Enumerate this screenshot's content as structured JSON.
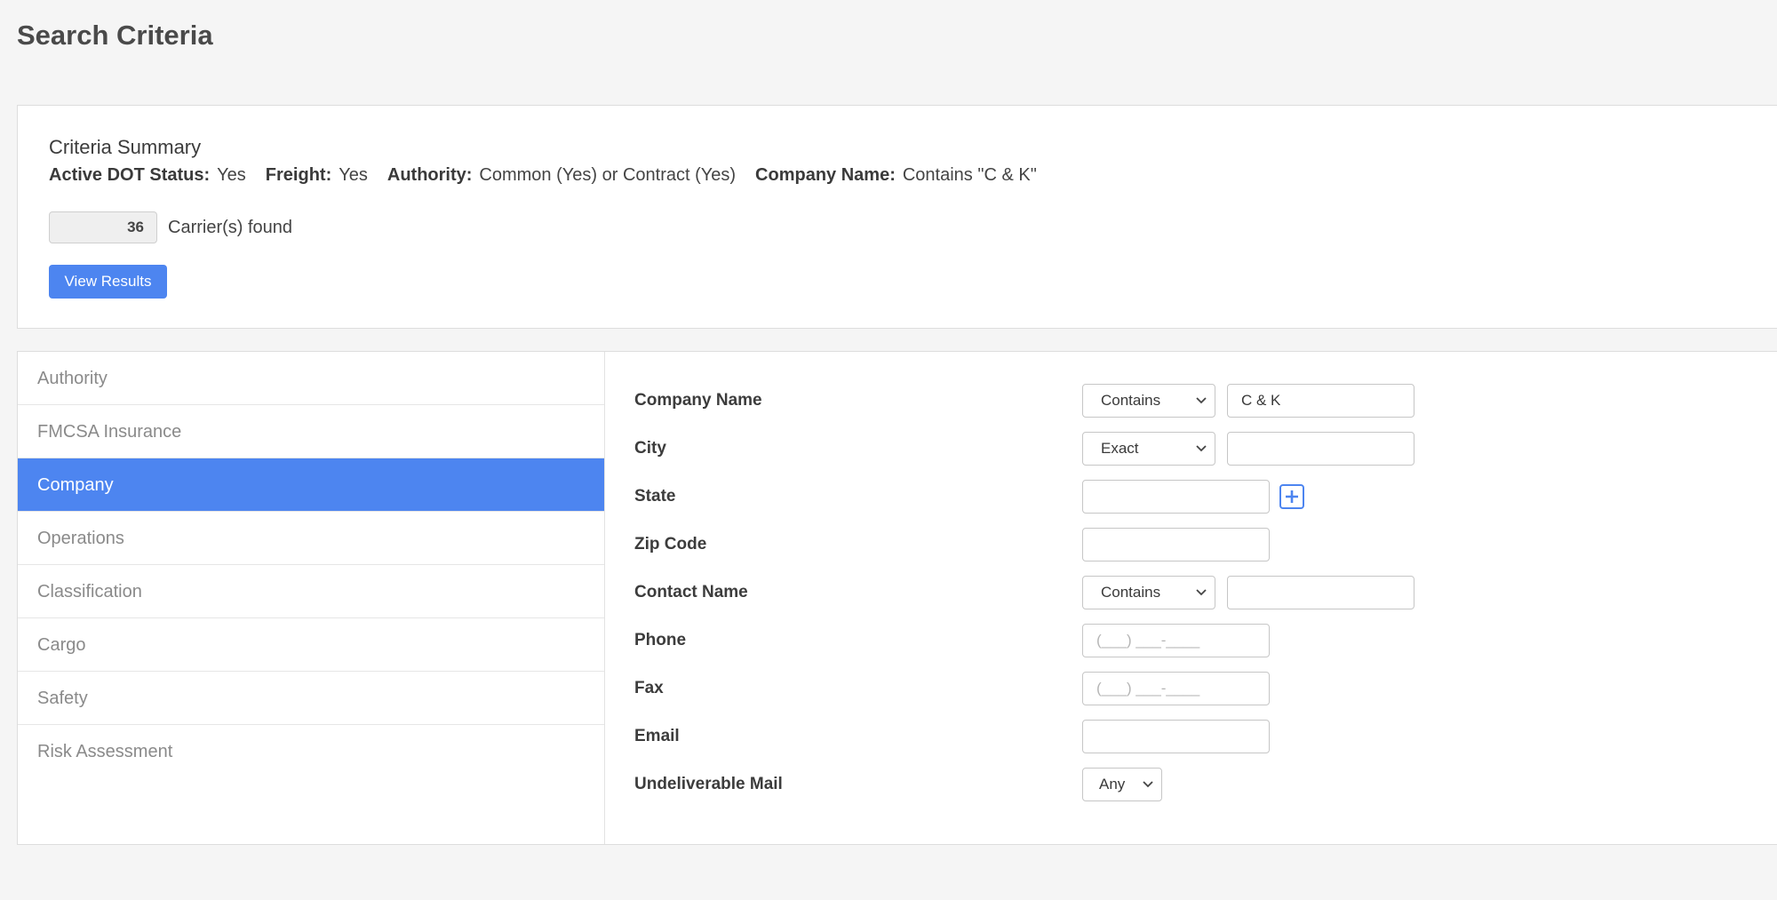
{
  "page": {
    "title": "Search Criteria"
  },
  "summary": {
    "title": "Criteria Summary",
    "criteria": [
      {
        "label": "Active DOT Status:",
        "value": "Yes"
      },
      {
        "label": "Freight:",
        "value": "Yes"
      },
      {
        "label": "Authority:",
        "value": "Common (Yes) or Contract (Yes)"
      },
      {
        "label": "Company Name:",
        "value": "Contains \"C & K\""
      }
    ],
    "count": "36",
    "count_label": "Carrier(s) found",
    "view_results_label": "View Results"
  },
  "sidebar": {
    "items": [
      {
        "label": "Authority",
        "active": false
      },
      {
        "label": "FMCSA Insurance",
        "active": false
      },
      {
        "label": "Company",
        "active": true
      },
      {
        "label": "Operations",
        "active": false
      },
      {
        "label": "Classification",
        "active": false
      },
      {
        "label": "Cargo",
        "active": false
      },
      {
        "label": "Safety",
        "active": false
      },
      {
        "label": "Risk Assessment",
        "active": false
      }
    ]
  },
  "form": {
    "company_name": {
      "label": "Company Name",
      "match": "Contains",
      "value": "C & K"
    },
    "city": {
      "label": "City",
      "match": "Exact",
      "value": ""
    },
    "state": {
      "label": "State",
      "value": ""
    },
    "zip": {
      "label": "Zip Code",
      "value": ""
    },
    "contact_name": {
      "label": "Contact Name",
      "match": "Contains",
      "value": ""
    },
    "phone": {
      "label": "Phone",
      "placeholder": "(___) ___-____"
    },
    "fax": {
      "label": "Fax",
      "placeholder": "(___) ___-____"
    },
    "email": {
      "label": "Email",
      "value": ""
    },
    "undeliverable_mail": {
      "label": "Undeliverable Mail",
      "value": "Any"
    }
  },
  "colors": {
    "accent": "#4d85f0",
    "background": "#f5f5f5",
    "card": "#ffffff"
  },
  "icons": {
    "dropdown": "chevron-down-icon",
    "add": "plus-icon"
  }
}
